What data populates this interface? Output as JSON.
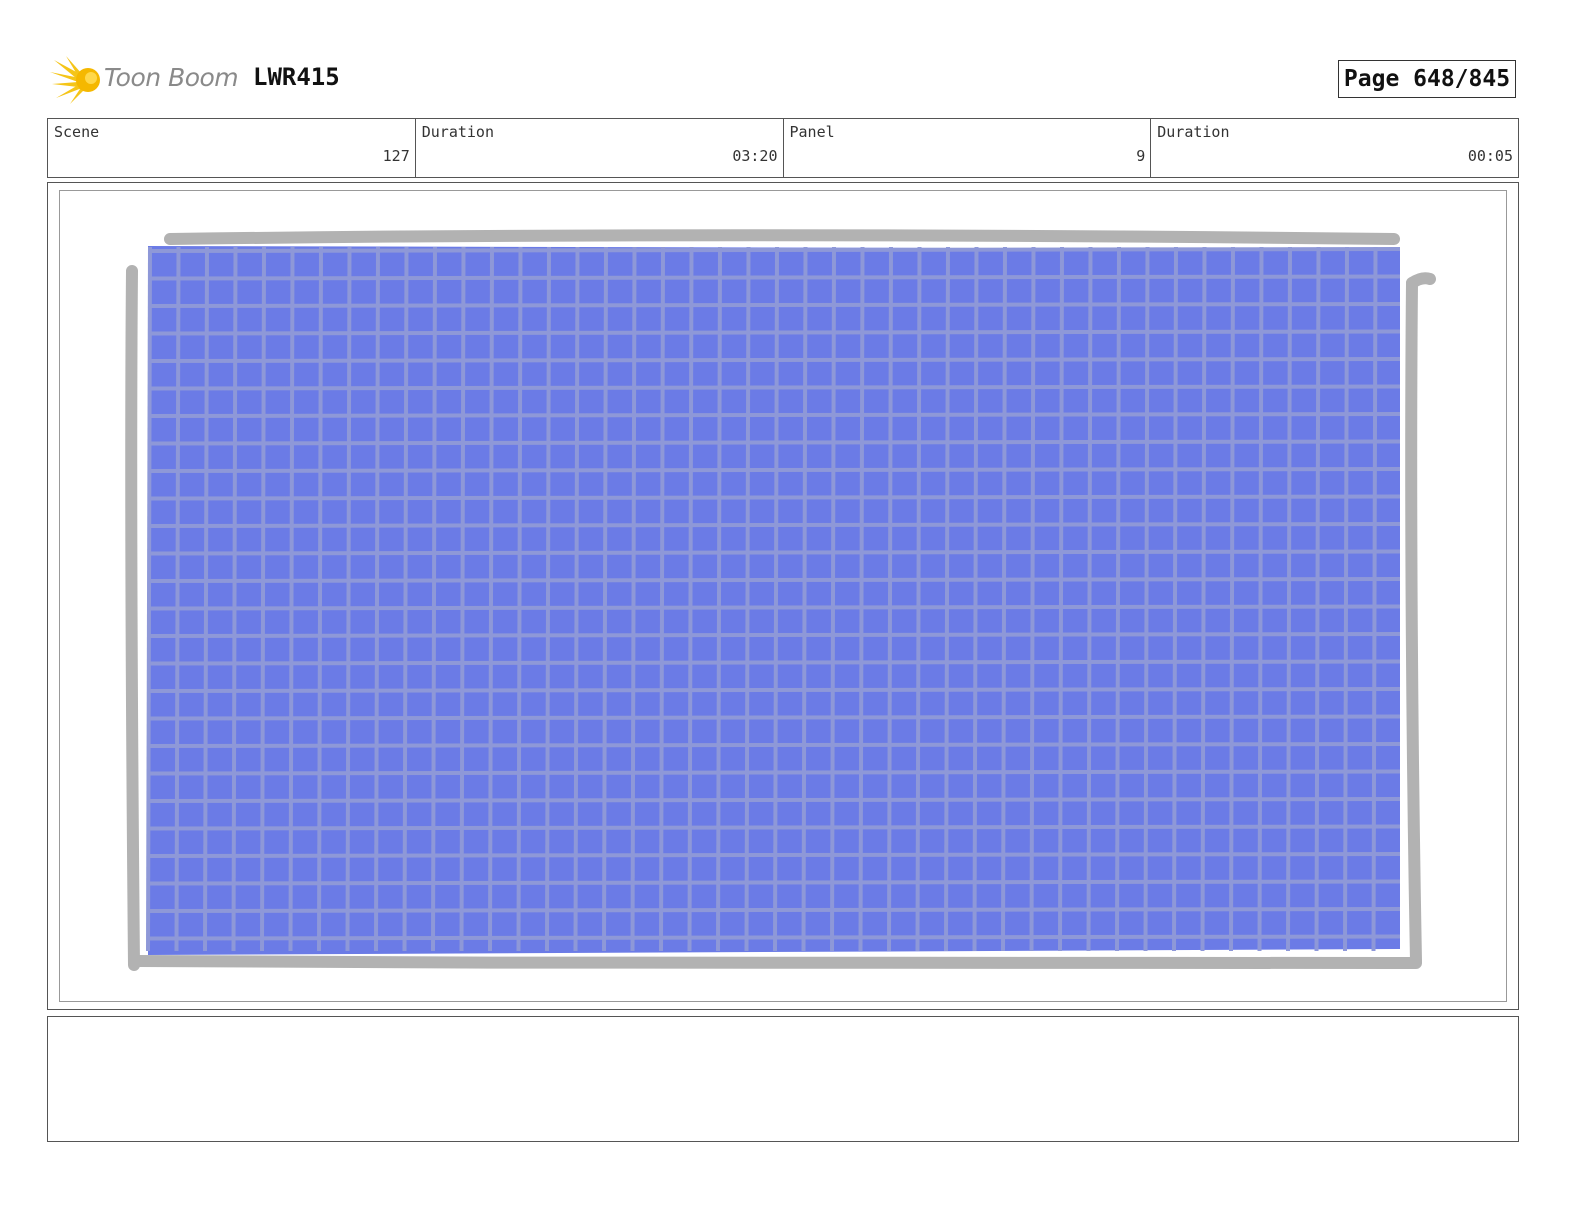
{
  "header": {
    "logo_text": "Toon Boom",
    "logo_icon": "starburst-icon",
    "project_code": "LWR415",
    "page_label": "Page 648/845"
  },
  "info": {
    "scene_label": "Scene",
    "scene_value": "127",
    "scene_duration_label": "Duration",
    "scene_duration_value": "03:20",
    "panel_label": "Panel",
    "panel_value": "9",
    "panel_duration_label": "Duration",
    "panel_duration_value": "00:05"
  },
  "drawing": {
    "fill_color": "#6b7be6",
    "grid_line_color": "#8e98d8",
    "outline_color": "#b2b2b2"
  },
  "notes": {
    "text": ""
  }
}
